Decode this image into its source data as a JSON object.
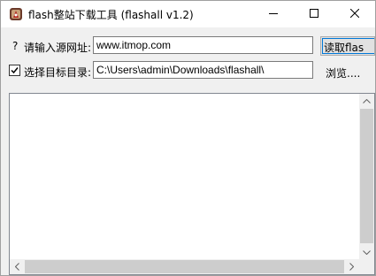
{
  "window": {
    "title": "flash整站下载工具 (flashall v1.2)"
  },
  "url_row": {
    "help_mark": "?",
    "label": "请输入源网址:",
    "value": "www.itmop.com",
    "read_button_label": "读取flas"
  },
  "dir_row": {
    "checkbox_checked": true,
    "label": "选择目标目录:",
    "value": "C:\\Users\\admin\\Downloads\\flashall\\",
    "browse_label": "浏览...."
  },
  "output": {
    "text": ""
  },
  "icons": {
    "app": "app-icon",
    "minimize": "minimize-icon",
    "maximize": "maximize-icon",
    "close": "close-icon",
    "check": "check-icon",
    "scroll_up": "scroll-up-arrow-icon",
    "scroll_down": "scroll-down-arrow-icon",
    "scroll_left": "scroll-left-arrow-icon",
    "scroll_right": "scroll-right-arrow-icon"
  },
  "colors": {
    "focus_accent": "#0078d7",
    "face": "#f0f0f0",
    "scroll_thumb": "#cdcdcd"
  }
}
